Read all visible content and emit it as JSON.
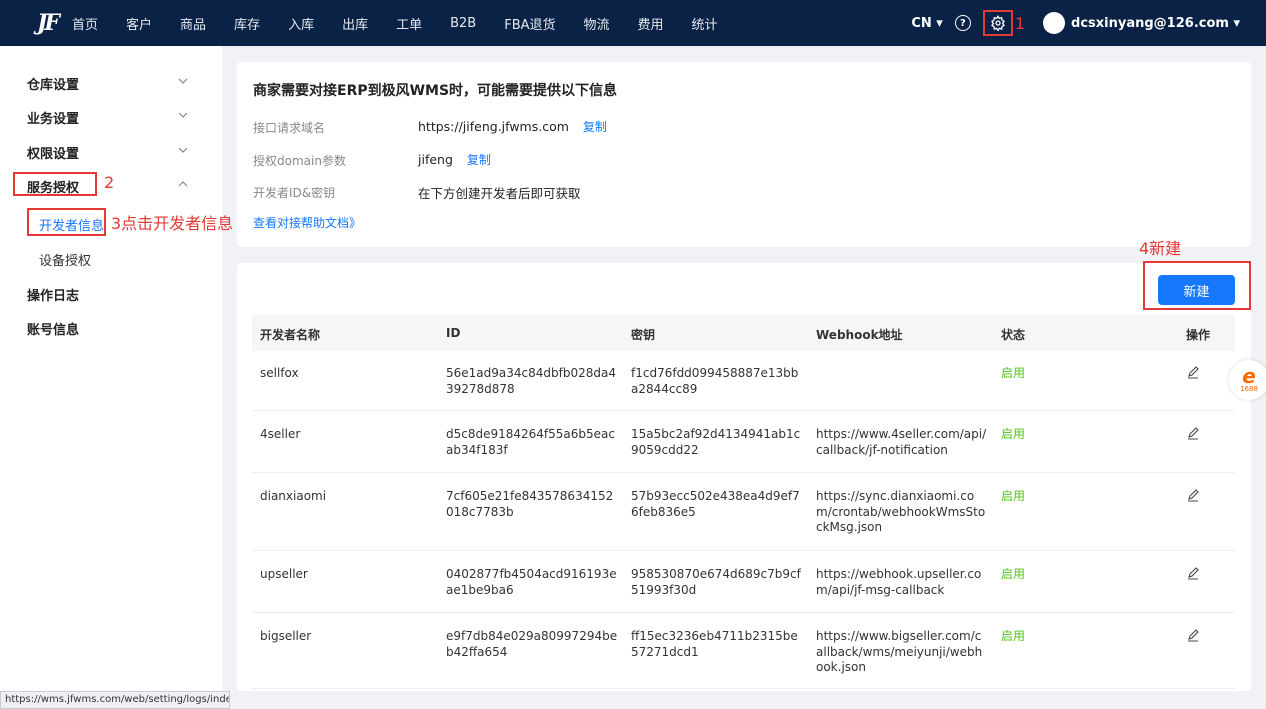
{
  "topnav": {
    "logo": "JF",
    "items": [
      "首页",
      "客户",
      "商品",
      "库存",
      "入库",
      "出库",
      "工单",
      "B2B",
      "FBA退货",
      "物流",
      "费用",
      "统计"
    ],
    "lang": "CN ▾",
    "help": "?",
    "user": "dcsxinyang@126.com ▾"
  },
  "annotations": {
    "a1": "1",
    "a2": "2",
    "a3": "3点击开发者信息",
    "a4": "4新建"
  },
  "sidebar": {
    "items": [
      "仓库设置",
      "业务设置",
      "权限设置",
      "服务授权"
    ],
    "subitems": [
      "开发者信息",
      "设备授权"
    ],
    "bottom_items": [
      "操作日志",
      "账号信息"
    ]
  },
  "statusbar": "https://wms.jfwms.com/web/setting/logs/index",
  "info": {
    "title": "商家需要对接ERP到极风WMS时，可能需要提供以下信息",
    "rows": [
      {
        "label": "接口请求域名",
        "value": "https://jifeng.jfwms.com",
        "copy": "复制"
      },
      {
        "label": "授权domain参数",
        "value": "jifeng",
        "copy": "复制"
      },
      {
        "label": "开发者ID&密钥",
        "value": "在下方创建开发者后即可获取",
        "copy": ""
      }
    ],
    "doc_link": "查看对接帮助文档》"
  },
  "table": {
    "new_button": "新建",
    "headers": [
      "开发者名称",
      "ID",
      "密钥",
      "Webhook地址",
      "状态",
      "操作"
    ],
    "rows": [
      {
        "name": "sellfox",
        "id": "56e1ad9a34c84dbfb028da439278d878",
        "secret": "f1cd76fdd099458887e13bba2844cc89",
        "webhook": "",
        "status": "启用"
      },
      {
        "name": "4seller",
        "id": "d5c8de9184264f55a6b5eacab34f183f",
        "secret": "15a5bc2af92d4134941ab1c9059cdd22",
        "webhook": "https://www.4seller.com/api/callback/jf-notification",
        "status": "启用"
      },
      {
        "name": "dianxiaomi",
        "id": "7cf605e21fe843578634152018c7783b",
        "secret": "57b93ecc502e438ea4d9ef76feb836e5",
        "webhook": "https://sync.dianxiaomi.com/crontab/webhookWmsStockMsg.json",
        "status": "启用"
      },
      {
        "name": "upseller",
        "id": "0402877fb4504acd916193eae1be9ba6",
        "secret": "958530870e674d689c7b9cf51993f30d",
        "webhook": "https://webhook.upseller.com/api/jf-msg-callback",
        "status": "启用"
      },
      {
        "name": "bigseller",
        "id": "e9f7db84e029a80997294beb42ffa654",
        "secret": "ff15ec3236eb4711b2315be57271dcd1",
        "webhook": "https://www.bigseller.com/callback/wms/meiyunji/webhook.json",
        "status": "启用"
      }
    ]
  },
  "float_badge": "1688",
  "colors": {
    "nav_bg": "#0a2246",
    "primary": "#1677ff",
    "success": "#52c41a",
    "annotation": "#e53935"
  }
}
